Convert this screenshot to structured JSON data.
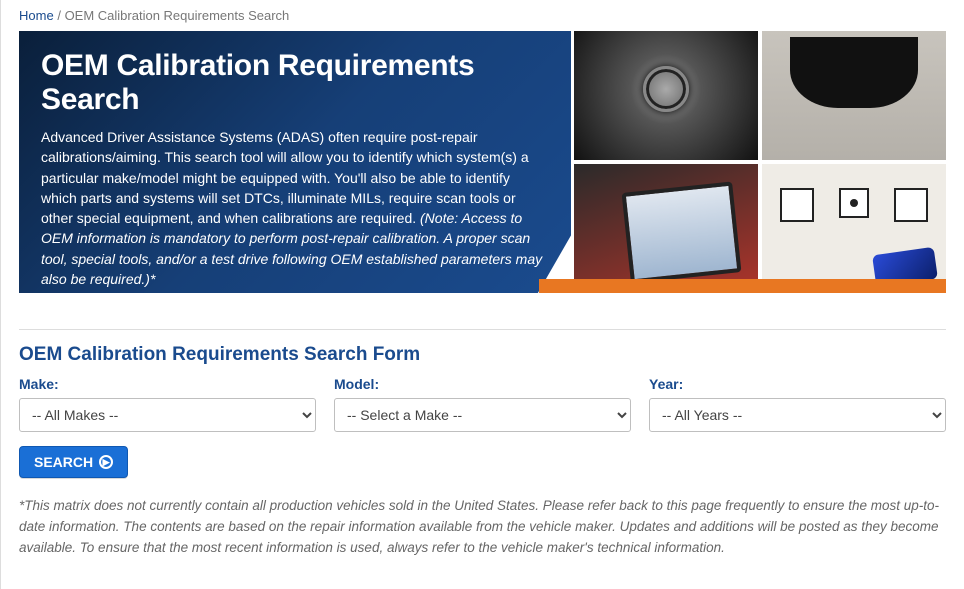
{
  "breadcrumb": {
    "home_label": "Home",
    "sep": "/",
    "current": "OEM Calibration Requirements Search"
  },
  "hero": {
    "title": "OEM Calibration Requirements Search",
    "description": "Advanced Driver Assistance Systems (ADAS) often require post-repair calibrations/aiming. This search tool will allow you to identify which system(s) a particular make/model might be equipped with. You'll also be able to identify which parts and systems will set DTCs, illuminate MILs, require scan tools or other special equipment, and when calibrations are required. ",
    "note": "(Note: Access to OEM information is mandatory to perform post-repair calibration. A proper scan tool, special tools, and/or a test drive following OEM established parameters may also be required.)*",
    "images": {
      "top_left": "vehicle-camera-sensor",
      "top_right": "rearview-mirror-sensor",
      "bottom_left": "technician-scan-tool",
      "bottom_right": "calibration-targets"
    }
  },
  "form": {
    "title": "OEM Calibration Requirements Search Form",
    "make": {
      "label": "Make:",
      "selected": "-- All Makes --"
    },
    "model": {
      "label": "Model:",
      "selected": "-- Select a Make --"
    },
    "year": {
      "label": "Year:",
      "selected": "-- All Years --"
    },
    "search_label": "SEARCH"
  },
  "disclaimer": "*This matrix does not currently contain all production vehicles sold in the United States. Please refer back to this page frequently to ensure the most up-to-date information. The contents are based on the repair information available from the vehicle maker. Updates and additions will be posted as they become available. To ensure that the most recent information is used, always refer to the vehicle maker's technical information."
}
